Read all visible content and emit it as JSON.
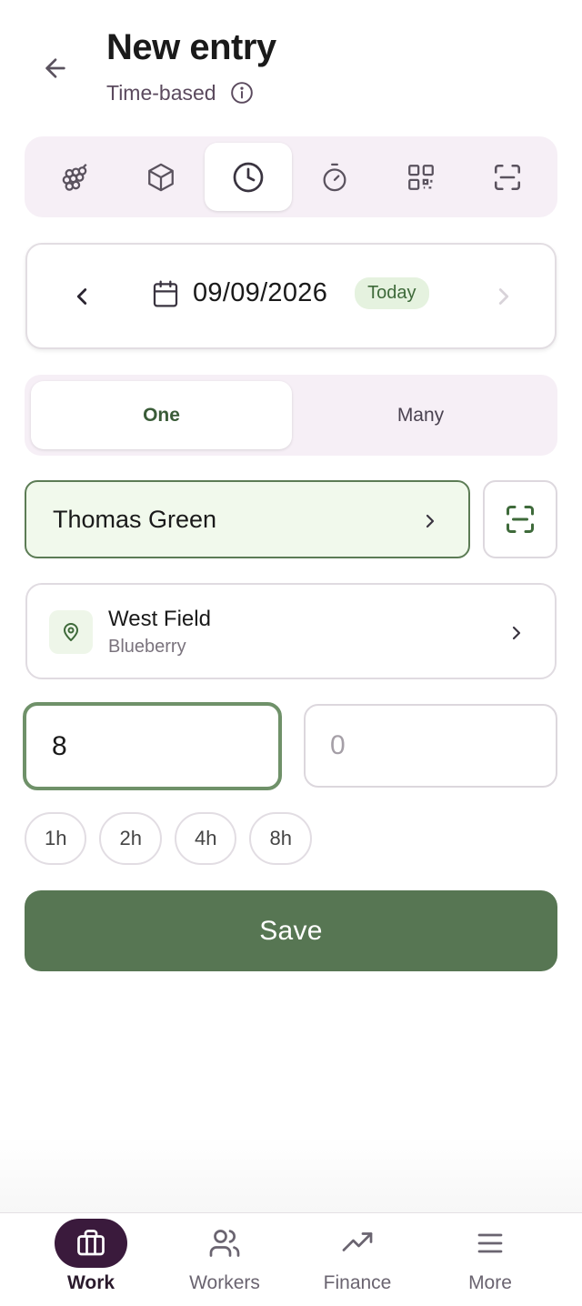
{
  "header": {
    "title": "New entry",
    "subtitle": "Time-based",
    "back_icon": "arrow-left-icon",
    "info_icon": "info-circle-icon"
  },
  "entry_modes": [
    {
      "icon": "grapes-icon",
      "active": false
    },
    {
      "icon": "box-icon",
      "active": false
    },
    {
      "icon": "clock-icon",
      "active": true
    },
    {
      "icon": "stopwatch-icon",
      "active": false
    },
    {
      "icon": "qr-code-icon",
      "active": false
    },
    {
      "icon": "scan-frame-icon",
      "active": false
    }
  ],
  "date": {
    "value": "09/09/2026",
    "badge": "Today"
  },
  "segment": {
    "one_label": "One",
    "many_label": "Many",
    "selected": "One"
  },
  "worker": {
    "name": "Thomas Green"
  },
  "location": {
    "title": "West Field",
    "subtitle": "Blueberry"
  },
  "hours_input": {
    "value": "8"
  },
  "minutes_input": {
    "placeholder": "0"
  },
  "quick_hours": [
    "1h",
    "2h",
    "4h",
    "8h"
  ],
  "save_label": "Save",
  "nav": {
    "items": [
      {
        "label": "Work",
        "icon": "briefcase-icon",
        "active": true
      },
      {
        "label": "Workers",
        "icon": "users-icon",
        "active": false
      },
      {
        "label": "Finance",
        "icon": "trending-up-icon",
        "active": false
      },
      {
        "label": "More",
        "icon": "menu-icon",
        "active": false
      }
    ]
  },
  "colors": {
    "primary_green": "#577653",
    "active_nav": "#3a1a3c",
    "segment_bg": "#f6eff6",
    "worker_bg": "#f1f9ec",
    "today_badge_bg": "#e5f2df"
  }
}
